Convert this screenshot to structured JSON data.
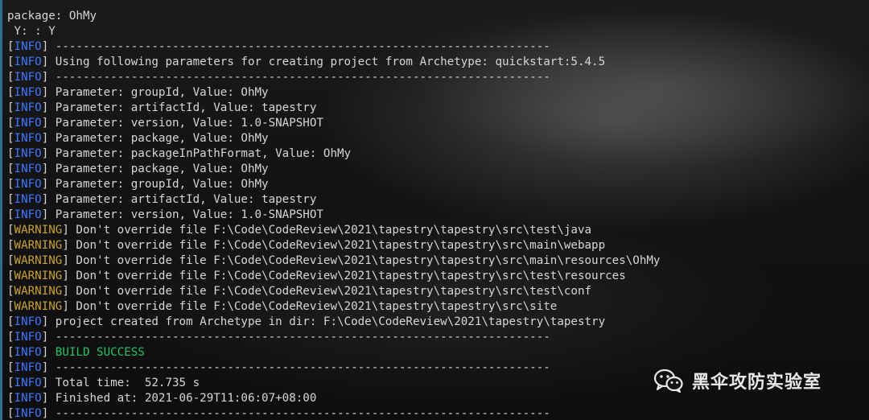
{
  "terminal": {
    "prompt_lines": [
      "package: OhMy",
      " Y: : Y"
    ],
    "log": [
      {
        "level": "INFO",
        "text": " ------------------------------------------------------------------------"
      },
      {
        "level": "INFO",
        "text": " Using following parameters for creating project from Archetype: quickstart:5.4.5"
      },
      {
        "level": "INFO",
        "text": " ------------------------------------------------------------------------"
      },
      {
        "level": "INFO",
        "text": " Parameter: groupId, Value: OhMy"
      },
      {
        "level": "INFO",
        "text": " Parameter: artifactId, Value: tapestry"
      },
      {
        "level": "INFO",
        "text": " Parameter: version, Value: 1.0-SNAPSHOT"
      },
      {
        "level": "INFO",
        "text": " Parameter: package, Value: OhMy"
      },
      {
        "level": "INFO",
        "text": " Parameter: packageInPathFormat, Value: OhMy"
      },
      {
        "level": "INFO",
        "text": " Parameter: package, Value: OhMy"
      },
      {
        "level": "INFO",
        "text": " Parameter: groupId, Value: OhMy"
      },
      {
        "level": "INFO",
        "text": " Parameter: artifactId, Value: tapestry"
      },
      {
        "level": "INFO",
        "text": " Parameter: version, Value: 1.0-SNAPSHOT"
      },
      {
        "level": "WARNING",
        "text": " Don't override file F:\\Code\\CodeReview\\2021\\tapestry\\tapestry\\src\\test\\java"
      },
      {
        "level": "WARNING",
        "text": " Don't override file F:\\Code\\CodeReview\\2021\\tapestry\\tapestry\\src\\main\\webapp"
      },
      {
        "level": "WARNING",
        "text": " Don't override file F:\\Code\\CodeReview\\2021\\tapestry\\tapestry\\src\\main\\resources\\OhMy"
      },
      {
        "level": "WARNING",
        "text": " Don't override file F:\\Code\\CodeReview\\2021\\tapestry\\tapestry\\src\\test\\resources"
      },
      {
        "level": "WARNING",
        "text": " Don't override file F:\\Code\\CodeReview\\2021\\tapestry\\tapestry\\src\\test\\conf"
      },
      {
        "level": "WARNING",
        "text": " Don't override file F:\\Code\\CodeReview\\2021\\tapestry\\tapestry\\src\\site"
      },
      {
        "level": "INFO",
        "text": " project created from Archetype in dir: F:\\Code\\CodeReview\\2021\\tapestry\\tapestry"
      },
      {
        "level": "INFO",
        "text": " ------------------------------------------------------------------------"
      },
      {
        "level": "INFO",
        "text": " BUILD SUCCESS",
        "highlight": "success"
      },
      {
        "level": "INFO",
        "text": " ------------------------------------------------------------------------"
      },
      {
        "level": "INFO",
        "text": " Total time:  52.735 s"
      },
      {
        "level": "INFO",
        "text": " Finished at: 2021-06-29T11:06:07+08:00"
      },
      {
        "level": "INFO",
        "text": " ------------------------------------------------------------------------"
      }
    ]
  },
  "watermark": {
    "icon": "wechat-icon",
    "text": "黑伞攻防实验室"
  },
  "colors": {
    "info": "#3b78ff",
    "warning": "#c9a227",
    "success": "#23c45d",
    "text": "#d6d6d6"
  }
}
